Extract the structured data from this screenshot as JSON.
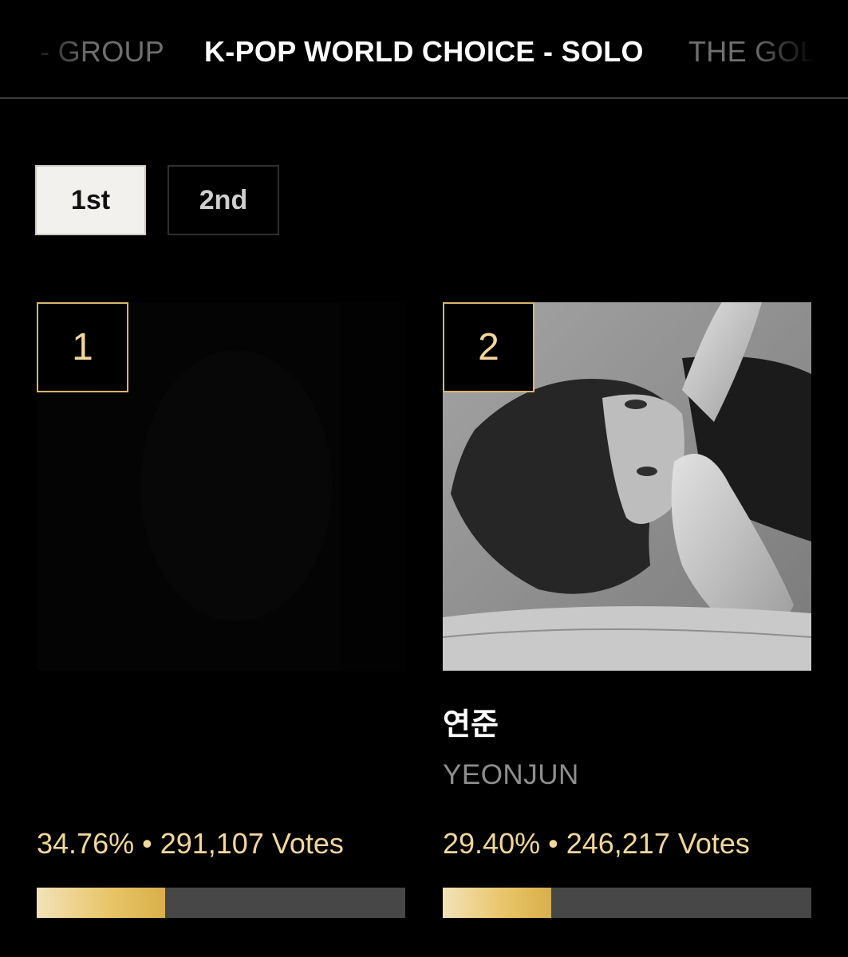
{
  "tabs": [
    {
      "label": "- GROUP",
      "active": false
    },
    {
      "label": "K-POP WORLD CHOICE - SOLO",
      "active": true
    },
    {
      "label": "THE GOL",
      "active": false
    }
  ],
  "rounds": [
    {
      "label": "1st",
      "selected": true
    },
    {
      "label": "2nd",
      "selected": false
    }
  ],
  "candidates": [
    {
      "rank": "1",
      "name_ko": "",
      "name_en": "",
      "percent_text": "34.76%",
      "votes_text": "291,107 Votes",
      "share": 0.3476,
      "photo_alt": "dark artist photo"
    },
    {
      "rank": "2",
      "name_ko": "연준",
      "name_en": "YEONJUN",
      "percent_text": "29.40%",
      "votes_text": "246,217 Votes",
      "share": 0.294,
      "photo_alt": "black and white artist photo"
    }
  ],
  "colors": {
    "accent_gold": "#e9c66a",
    "gold_text": "#f1d79c",
    "background": "#000000",
    "bar_track": "#474747"
  }
}
